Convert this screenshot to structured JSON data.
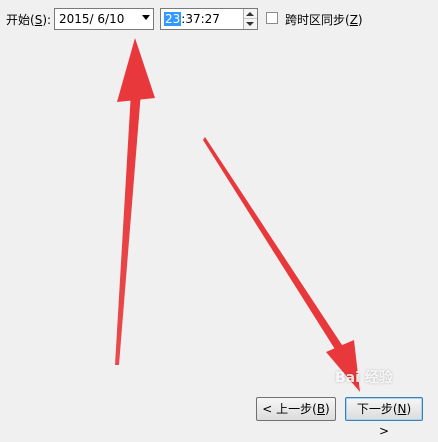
{
  "start_label": "开始(",
  "start_hotkey": "S",
  "start_label_end": "):",
  "date_value": "2015/  6/10",
  "time_selected": "23",
  "time_rest": ":37:27",
  "checkbox": {
    "label": "跨时区同步(",
    "hotkey": "Z",
    "label_end": ")",
    "checked": false
  },
  "buttons": {
    "back": {
      "prefix": "< 上一步(",
      "hotkey": "B",
      "suffix": ")"
    },
    "next": {
      "prefix": "下一步(",
      "hotkey": "N",
      "suffix": ") >"
    }
  },
  "annotation_color": "#e8383b",
  "watermark": "Bai 经验"
}
